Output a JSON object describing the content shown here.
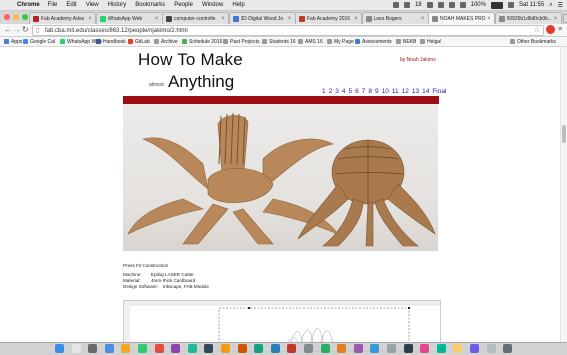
{
  "menubar": {
    "apple_icon": "apple-icon",
    "app": "Chrome",
    "items": [
      "File",
      "Edit",
      "View",
      "History",
      "Bookmarks",
      "People",
      "Window",
      "Help"
    ],
    "battery_pct": "100%",
    "clock": "Sat 11:55",
    "badge": "18"
  },
  "tabs": [
    {
      "title": "Fab Academy Adva",
      "color": "#b22222"
    },
    {
      "title": "WhatsApp Web",
      "color": "#25d366"
    },
    {
      "title": "computer-controlle",
      "color": "#444444"
    },
    {
      "title": "3D Digital Wood Jo",
      "color": "#3b7bd6"
    },
    {
      "title": "Fab Academy 2016",
      "color": "#c0392b"
    },
    {
      "title": "Loes Bogers",
      "color": "#888888"
    },
    {
      "title": "NOAH MAKES PRO...",
      "color": "#888888"
    },
    {
      "title": "50926b1d6d0cb0b...",
      "color": "#888888"
    }
  ],
  "active_tab_index": 6,
  "address": {
    "url": "fab.cba.mit.edu/classes/863.12/people/njakimo/2.html"
  },
  "bookmarks": [
    {
      "label": "Apps",
      "color": "#4a7fd4"
    },
    {
      "label": "Google Cal",
      "color": "#4285f4"
    },
    {
      "label": "WhatsApp Web",
      "color": "#25d366"
    },
    {
      "label": "Handbook",
      "color": "#3b5998"
    },
    {
      "label": "GitLab",
      "color": "#e24329"
    },
    {
      "label": "Archive",
      "color": "#999999"
    },
    {
      "label": "Schedule 2016",
      "color": "#4caf50"
    },
    {
      "label": "Past Projects",
      "color": "#999999"
    },
    {
      "label": "Students 16",
      "color": "#999999"
    },
    {
      "label": "AMS 16",
      "color": "#999999"
    },
    {
      "label": "My Page",
      "color": "#999999"
    },
    {
      "label": "Assessments",
      "color": "#3b7bd6"
    },
    {
      "label": "BEKB",
      "color": "#999999"
    },
    {
      "label": "Helga!",
      "color": "#999999"
    },
    {
      "label": "Other Bookmarks",
      "color": "#999999"
    }
  ],
  "page": {
    "title_line1": "How To Make",
    "title_small": "almost",
    "title_line2": "Anything",
    "byline": "by Noah Jakimo",
    "page_links": [
      "1",
      "2",
      "3",
      "4",
      "5",
      "6",
      "7",
      "8",
      "9",
      "10",
      "11",
      "12",
      "13",
      "14",
      "Final"
    ],
    "section_heading": "Press Fit Construction",
    "specs": [
      {
        "key": "Machine:",
        "value": "Epilog LASER Cutter"
      },
      {
        "key": "Material:",
        "value": "4mm-thick Cardboard"
      },
      {
        "key": "Design Software:",
        "value": "Inkscape, FAB Module"
      }
    ],
    "accent_color": "#9a0d12",
    "link_color": "#1a1ab0"
  },
  "dock_count": 28
}
